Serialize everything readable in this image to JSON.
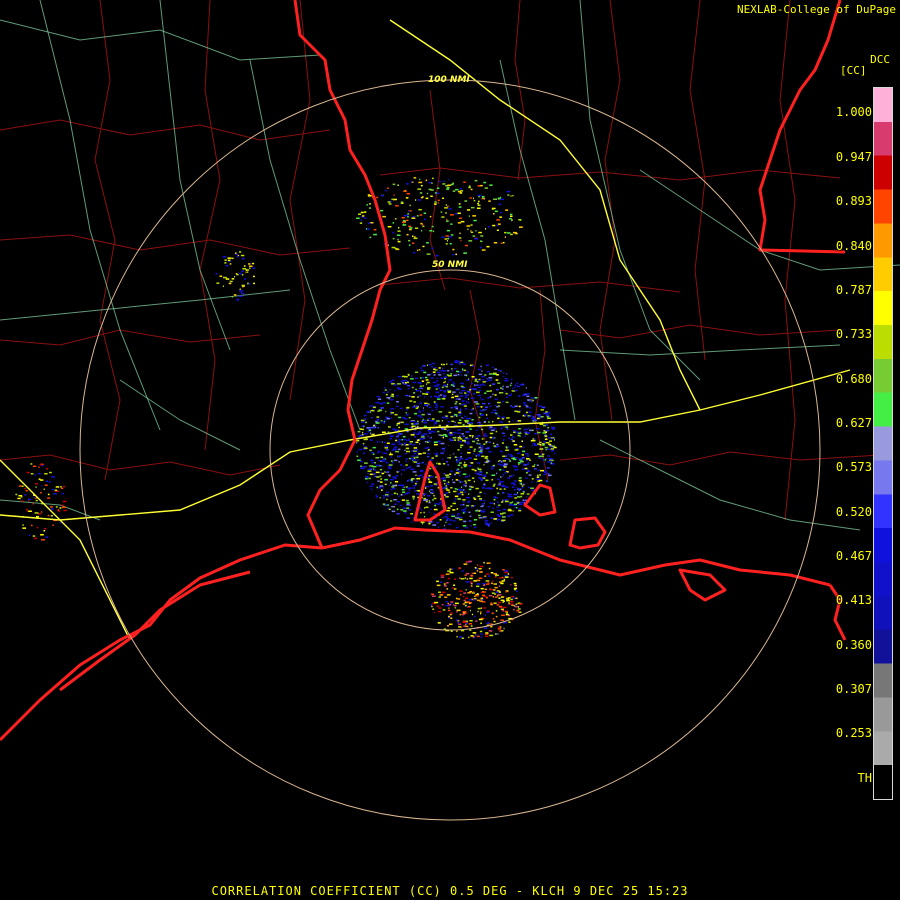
{
  "attribution": "NEXLAB-College of DuPage",
  "legend": {
    "product_code": "DCC",
    "unit": "[CC]",
    "labels": [
      "1.000",
      "0.947",
      "0.893",
      "0.840",
      "0.787",
      "0.733",
      "0.680",
      "0.627",
      "0.573",
      "0.520",
      "0.467",
      "0.413",
      "0.360",
      "0.307",
      "0.253",
      "TH"
    ],
    "colors": [
      "#ffb0d8",
      "#d83c6e",
      "#cc0000",
      "#ff4400",
      "#ff9900",
      "#ffcc00",
      "#ffff00",
      "#bbdd00",
      "#77cc33",
      "#44ee44",
      "#9999dd",
      "#7777ee",
      "#3333ff",
      "#1111dd",
      "#1111cc",
      "#1111bb",
      "#111199",
      "#777777",
      "#999999",
      "#aaaaaa",
      "#000000"
    ]
  },
  "range_rings": {
    "inner_label": "50 NMI",
    "outer_label": "100 NMI"
  },
  "footer": "CORRELATION COEFFICIENT (CC) 0.5 DEG - KLCH 9 DEC 25 15:23",
  "colors": {
    "coastline": "#ff2020",
    "county_lines": "#8a1010",
    "state_lines": "#c00000",
    "highways": "#ffff33",
    "roads": "#88ddaa",
    "range_rings": "#d9b690",
    "radar_site": "#000000"
  }
}
